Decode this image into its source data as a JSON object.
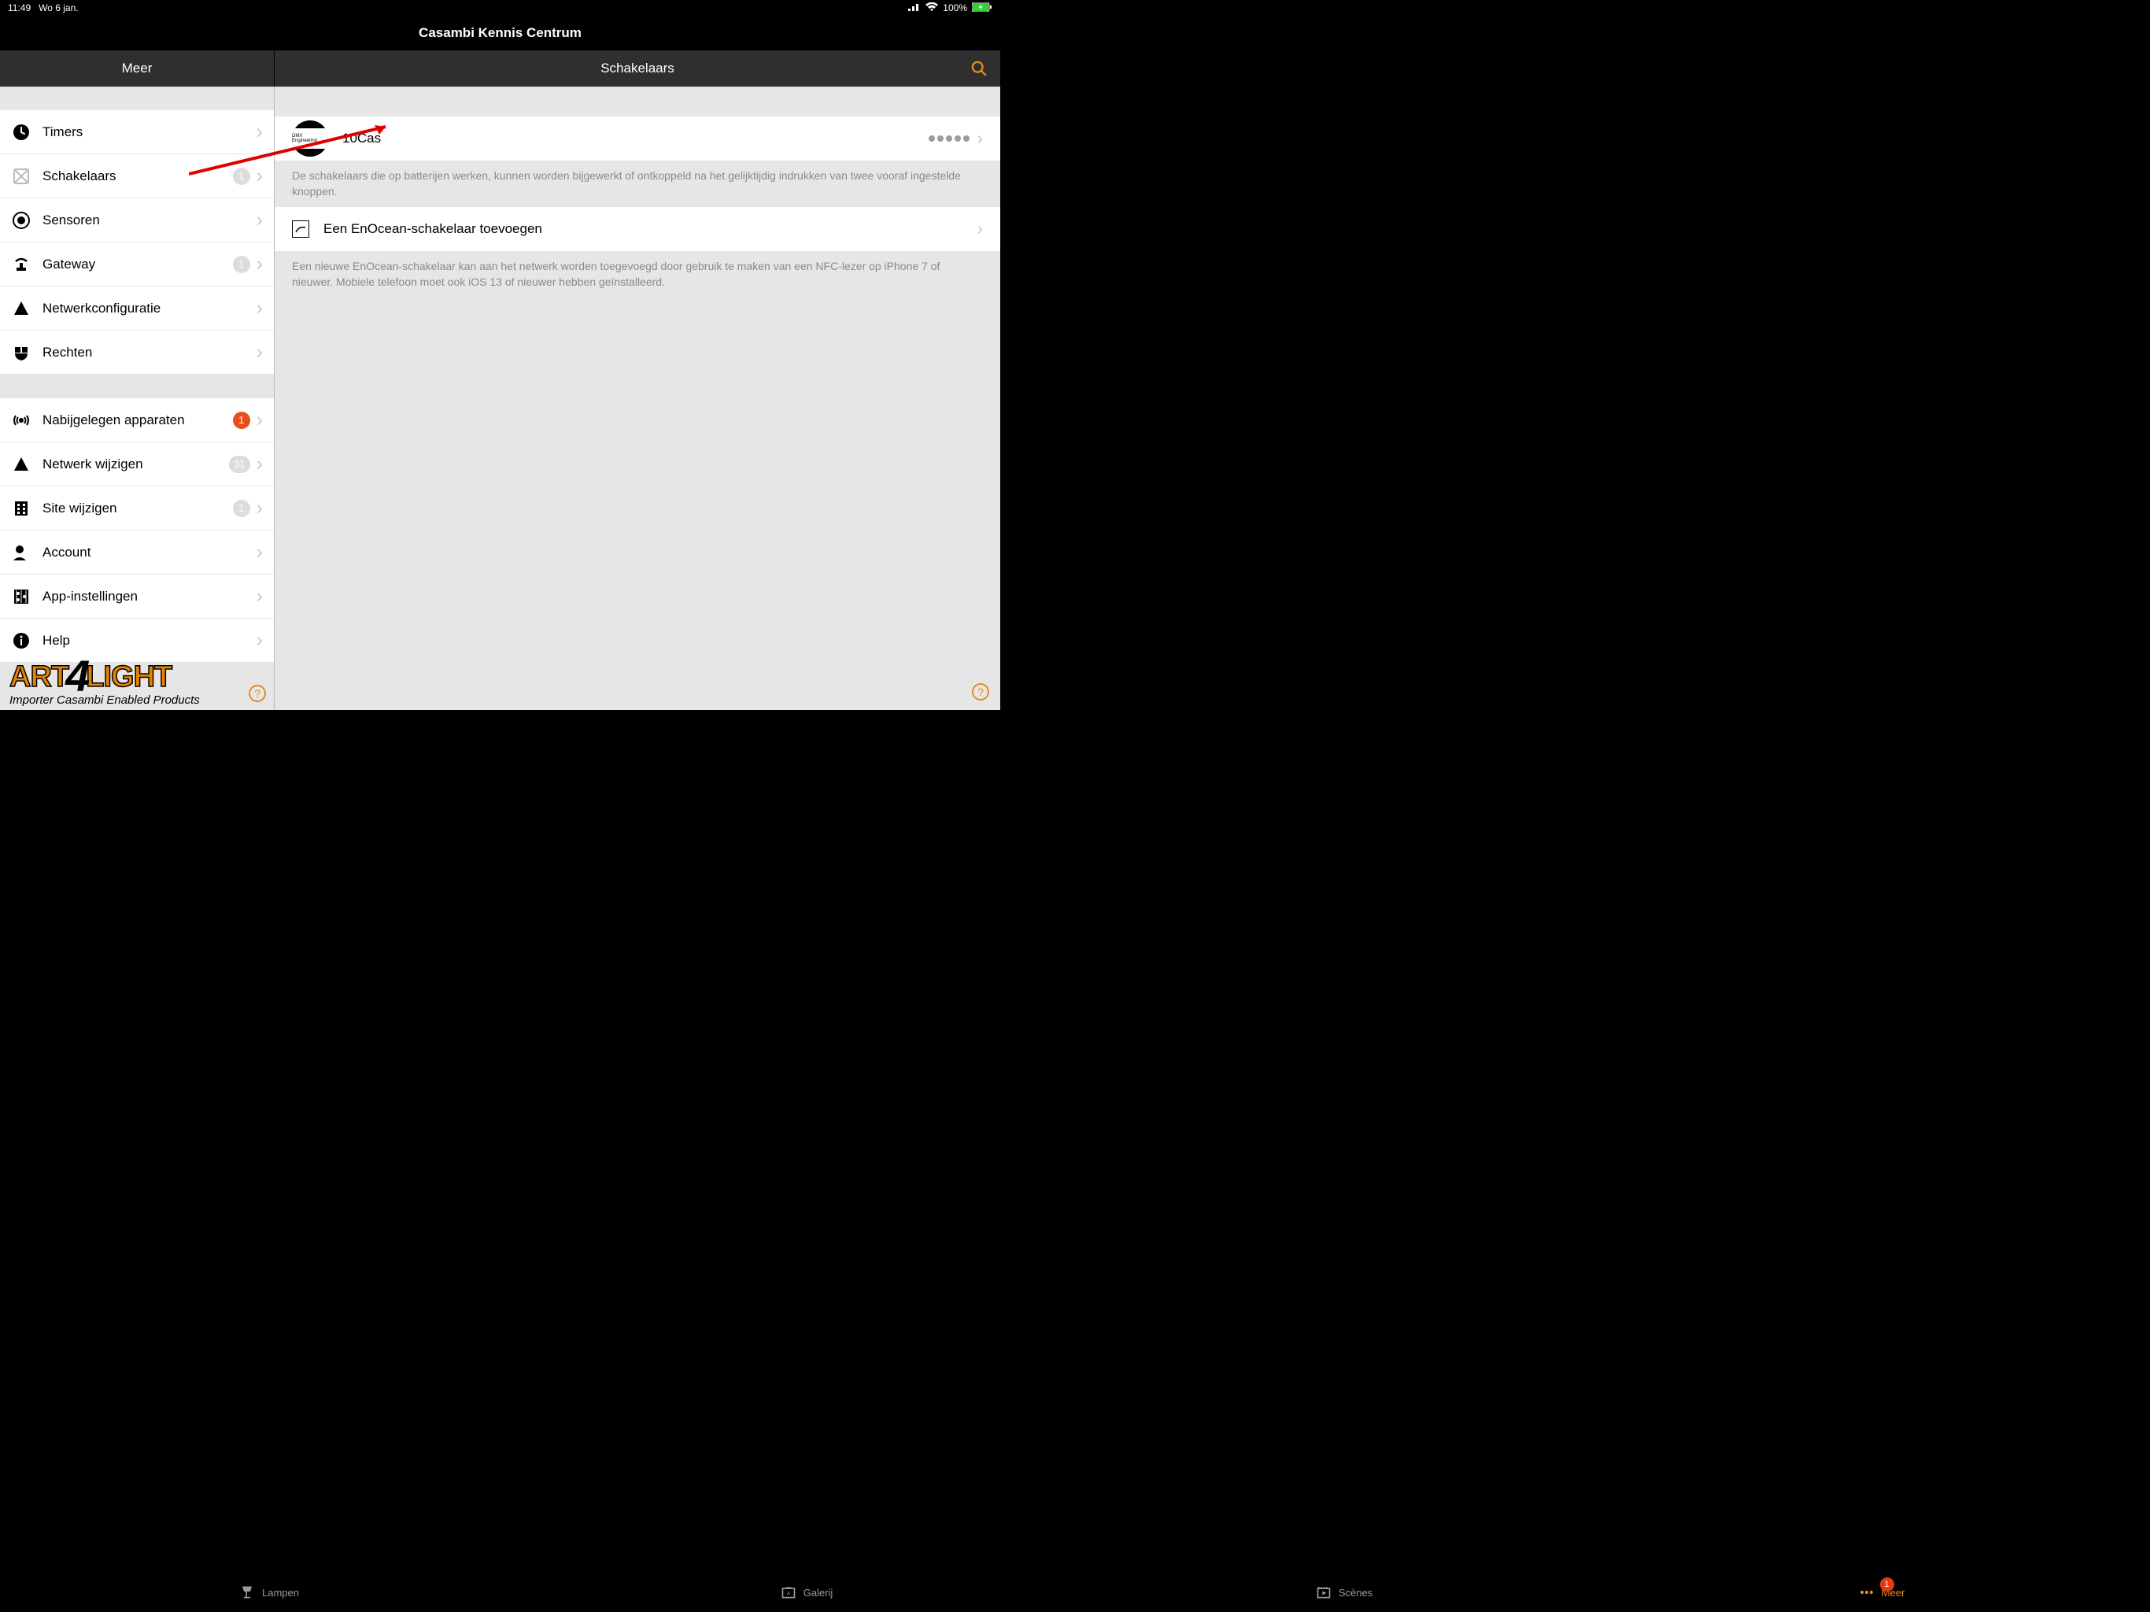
{
  "status": {
    "time": "11:49",
    "date": "Wo 6 jan.",
    "battery": "100%"
  },
  "app_title": "Casambi Kennis Centrum",
  "toolbar": {
    "left": "Meer",
    "right": "Schakelaars"
  },
  "sidebar": {
    "group1": [
      {
        "label": "Timers",
        "badge": null
      },
      {
        "label": "Schakelaars",
        "badge": "1",
        "badge_color": "gray"
      },
      {
        "label": "Sensoren",
        "badge": null
      },
      {
        "label": "Gateway",
        "badge": "1",
        "badge_color": "gray"
      },
      {
        "label": "Netwerkconfiguratie",
        "badge": null
      },
      {
        "label": "Rechten",
        "badge": null
      }
    ],
    "group2": [
      {
        "label": "Nabijgelegen apparaten",
        "badge": "1",
        "badge_color": "red"
      },
      {
        "label": "Netwerk wijzigen",
        "badge": "31",
        "badge_color": "gray"
      },
      {
        "label": "Site wijzigen",
        "badge": "1",
        "badge_color": "gray"
      },
      {
        "label": "Account",
        "badge": null
      },
      {
        "label": "App-instellingen",
        "badge": null
      },
      {
        "label": "Help",
        "badge": null
      }
    ]
  },
  "detail": {
    "device": {
      "thumb_text": "DMX Engineering",
      "name": "10Cas",
      "dot_count": 5
    },
    "desc1": "De schakelaars die op batterijen werken, kunnen worden bijgewerkt of ontkoppeld na het gelijktijdig indrukken van twee vooraf ingestelde knoppen.",
    "add_label": "Een EnOcean-schakelaar toevoegen",
    "desc2": "Een nieuwe EnOcean-schakelaar kan aan het netwerk worden toegevoegd door gebruik te maken van een NFC-lezer op iPhone 7 of nieuwer. Mobiele telefoon moet ook iOS 13 of nieuwer hebben geïnstalleerd."
  },
  "tabs": [
    {
      "label": "Lampen"
    },
    {
      "label": "Galerij"
    },
    {
      "label": "Scènes"
    },
    {
      "label": "Meer",
      "active": true,
      "badge": "1"
    }
  ],
  "logo": {
    "line1a": "ART",
    "four": "4",
    "line1b": "LIGHT",
    "line2": "Importer Casambi Enabled Products"
  },
  "help": "?"
}
